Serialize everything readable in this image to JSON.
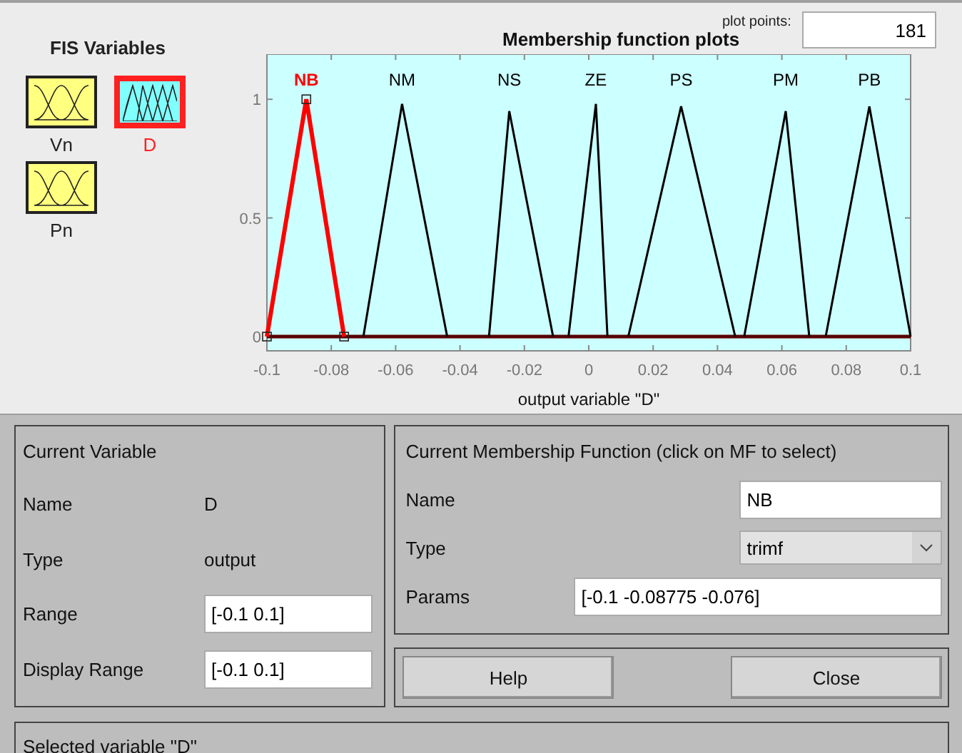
{
  "fis_variables": {
    "title": "FIS Variables",
    "items": [
      {
        "name": "Vn",
        "kind": "input",
        "selected": false
      },
      {
        "name": "D",
        "kind": "output",
        "selected": true
      },
      {
        "name": "Pn",
        "kind": "input",
        "selected": false
      }
    ]
  },
  "plot": {
    "plot_points_label": "plot points:",
    "plot_points": "181",
    "chart_data": {
      "type": "line",
      "title": "Membership function plots",
      "xlabel": "output variable \"D\"",
      "x": [
        -0.1,
        -0.08775,
        -0.076,
        -0.07,
        -0.058,
        -0.044,
        -0.031,
        -0.0247,
        -0.0111,
        -0.0063,
        0.0022,
        0.0058,
        0.0123,
        0.0287,
        0.0455,
        0.0483,
        0.0612,
        0.0685,
        0.0736,
        0.0872,
        0.1
      ],
      "xlim": [
        -0.1,
        0.1
      ],
      "ylim": [
        -0.06,
        1.19
      ],
      "xticks": [
        -0.1,
        -0.08,
        -0.06,
        -0.04,
        -0.02,
        0,
        0.02,
        0.04,
        0.06,
        0.08,
        0.1
      ],
      "yticks": [
        0,
        0.5,
        1
      ],
      "series": [
        {
          "name": "NB",
          "color": "#ff0000",
          "marker": "square",
          "values": [
            0,
            1,
            0,
            null,
            null,
            null,
            null,
            null,
            null,
            null,
            null,
            null,
            null,
            null,
            null,
            null,
            null,
            null,
            null,
            null,
            null
          ]
        },
        {
          "name": "NM",
          "color": "#000000",
          "values": [
            null,
            null,
            null,
            0,
            0.98,
            0,
            null,
            null,
            null,
            null,
            null,
            null,
            null,
            null,
            null,
            null,
            null,
            null,
            null,
            null,
            null
          ]
        },
        {
          "name": "NS",
          "color": "#000000",
          "values": [
            null,
            null,
            null,
            null,
            null,
            null,
            0,
            0.95,
            0,
            null,
            null,
            null,
            null,
            null,
            null,
            null,
            null,
            null,
            null,
            null,
            null
          ]
        },
        {
          "name": "ZE",
          "color": "#000000",
          "values": [
            null,
            null,
            null,
            null,
            null,
            null,
            null,
            null,
            null,
            0,
            0.98,
            0,
            null,
            null,
            null,
            null,
            null,
            null,
            null,
            null,
            null
          ]
        },
        {
          "name": "PS",
          "color": "#000000",
          "values": [
            null,
            null,
            null,
            null,
            null,
            null,
            null,
            null,
            null,
            null,
            null,
            null,
            0,
            0.97,
            0,
            null,
            null,
            null,
            null,
            null,
            null
          ]
        },
        {
          "name": "PM",
          "color": "#000000",
          "values": [
            null,
            null,
            null,
            null,
            null,
            null,
            null,
            null,
            null,
            null,
            null,
            null,
            null,
            null,
            null,
            0,
            0.95,
            0,
            null,
            null,
            null
          ]
        },
        {
          "name": "PB",
          "color": "#000000",
          "values": [
            null,
            null,
            null,
            null,
            null,
            null,
            null,
            null,
            null,
            null,
            null,
            null,
            null,
            null,
            null,
            null,
            null,
            null,
            0,
            0.97,
            0
          ]
        }
      ]
    }
  },
  "current_variable": {
    "title": "Current Variable",
    "name_label": "Name",
    "name": "D",
    "type_label": "Type",
    "type": "output",
    "range_label": "Range",
    "range": "[-0.1 0.1]",
    "display_range_label": "Display Range",
    "display_range": "[-0.1 0.1]"
  },
  "current_mf": {
    "title": "Current Membership Function (click on MF to select)",
    "name_label": "Name",
    "name": "NB",
    "type_label": "Type",
    "type": "trimf",
    "params_label": "Params",
    "params": "[-0.1 -0.08775 -0.076]"
  },
  "buttons": [
    "Help",
    "Close"
  ],
  "status": "Selected variable \"D\""
}
